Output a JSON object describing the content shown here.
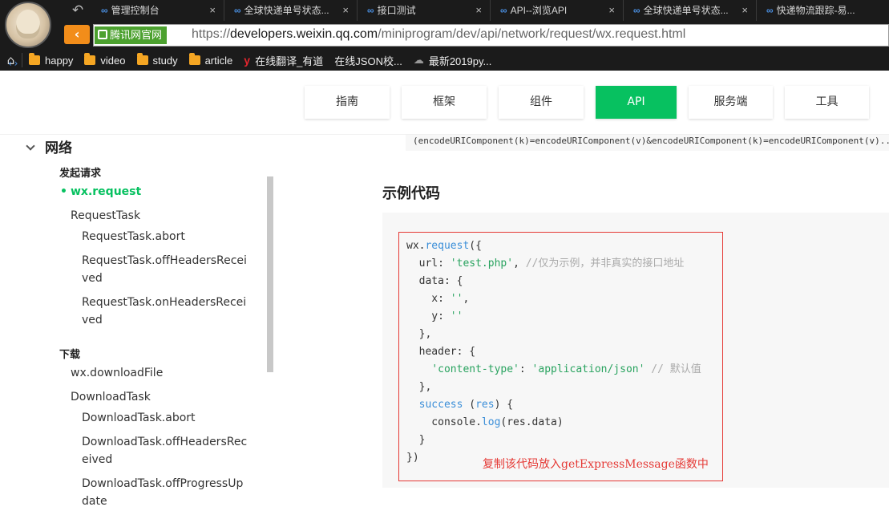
{
  "browser": {
    "tabs": [
      {
        "label": "管理控制台",
        "icon": "link-icon"
      },
      {
        "label": "全球快递单号状态...",
        "icon": "link-icon"
      },
      {
        "label": "接口测试",
        "icon": "link-icon"
      },
      {
        "label": "API--浏览API",
        "icon": "link-icon"
      },
      {
        "label": "全球快递单号状态...",
        "icon": "link-icon"
      },
      {
        "label": "快递物流跟踪-易...",
        "icon": "link-icon"
      }
    ],
    "close_glyph": "×",
    "site_badge": "腾讯网官网",
    "url_scheme": "https://",
    "url_host": "developers.weixin.qq.com",
    "url_path": "/miniprogram/dev/api/network/request/wx.request.html",
    "bookmarks": [
      {
        "label": "happy",
        "icon": "folder-icon"
      },
      {
        "label": "video",
        "icon": "folder-icon"
      },
      {
        "label": "study",
        "icon": "folder-icon"
      },
      {
        "label": "article",
        "icon": "folder-icon"
      },
      {
        "label": "在线翻译_有道",
        "icon": "youdao-icon"
      },
      {
        "label": "在线JSON校...",
        "icon": "code-icon"
      },
      {
        "label": "最新2019py...",
        "icon": "ghost-icon"
      }
    ]
  },
  "header": {
    "nav": [
      {
        "label": "指南",
        "active": false
      },
      {
        "label": "框架",
        "active": false
      },
      {
        "label": "组件",
        "active": false
      },
      {
        "label": "API",
        "active": true
      },
      {
        "label": "服务端",
        "active": false
      },
      {
        "label": "工具",
        "active": false
      }
    ],
    "accent_color": "#07c160"
  },
  "sidebar": {
    "section": "网络",
    "groups": [
      {
        "title": "发起请求"
      },
      {
        "title": "下载"
      }
    ],
    "items": [
      {
        "label": "wx.request",
        "active": true
      },
      {
        "label": "RequestTask"
      },
      {
        "label": "RequestTask.abort"
      },
      {
        "label": "RequestTask.offHeadersRecei",
        "cont": "ved"
      },
      {
        "label": "RequestTask.onHeadersRecei",
        "cont": "ved"
      },
      {
        "label": "wx.downloadFile"
      },
      {
        "label": "DownloadTask"
      },
      {
        "label": "DownloadTask.abort"
      },
      {
        "label": "DownloadTask.offHeadersRec",
        "cont": "eived"
      },
      {
        "label": "DownloadTask.offProgressUp",
        "cont": "date"
      }
    ]
  },
  "main": {
    "code_top": "(encodeURIComponent(k)=encodeURIComponent(v)&encodeURIComponent(k)=encodeURIComponent(v)...",
    "heading": "示例代码",
    "annotation": "复制该代码放入getExpressMessage函数中",
    "annotation_color": "#e53935"
  }
}
